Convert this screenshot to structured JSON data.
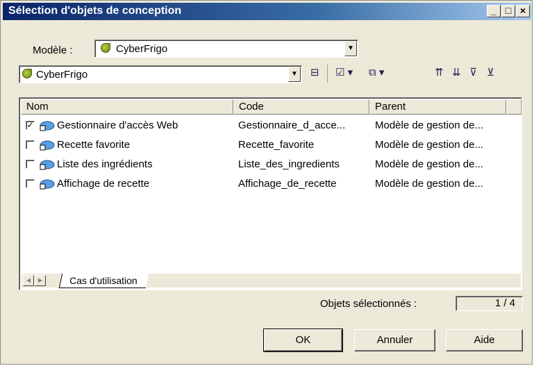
{
  "window": {
    "title": "Sélection d'objets de conception"
  },
  "titlebar_buttons": [
    "_",
    "□",
    "×"
  ],
  "model": {
    "label": "Modèle :",
    "value": "CyberFrigo"
  },
  "filter_combo": {
    "value": "CyberFrigo"
  },
  "toolbar": {
    "icons": [
      "tree-view-icon",
      "select-all-icon",
      "deselect-all-icon",
      "move-up-icon",
      "move-down-icon",
      "filter-icon",
      "clear-filter-icon"
    ]
  },
  "table": {
    "columns": [
      "Nom",
      "Code",
      "Parent"
    ],
    "rows": [
      {
        "checked": true,
        "nom": "Gestionnaire d'accès Web",
        "code": "Gestionnaire_d_acce...",
        "parent": "Modèle de gestion de..."
      },
      {
        "checked": false,
        "nom": "Recette favorite",
        "code": "Recette_favorite",
        "parent": "Modèle de gestion de..."
      },
      {
        "checked": false,
        "nom": "Liste des ingrédients",
        "code": "Liste_des_ingredients",
        "parent": "Modèle de gestion de..."
      },
      {
        "checked": false,
        "nom": "Affichage de recette",
        "code": "Affichage_de_recette",
        "parent": "Modèle de gestion de..."
      }
    ],
    "tab_label": "Cas d'utilisation"
  },
  "selection": {
    "label": "Objets sélectionnés :",
    "count": "1 / 4"
  },
  "buttons": {
    "ok": "OK",
    "cancel": "Annuler",
    "help": "Aide"
  }
}
